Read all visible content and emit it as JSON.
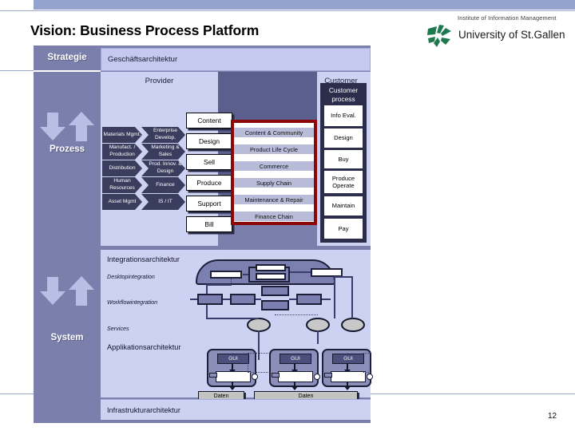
{
  "page": {
    "number": "12"
  },
  "header": {
    "title": "Vision: Business Process Platform",
    "logo_institute": "Institute of Information Management",
    "logo_university": "University of St.Gallen"
  },
  "layers": {
    "strategie": "Strategie",
    "prozess": "Prozess",
    "system": "System"
  },
  "business": {
    "architecture_bar": "Geschäftsarchitektur",
    "provider": "Provider",
    "customer": "Customer"
  },
  "provider_functions": [
    {
      "left": "Materials Mgmt.",
      "right": "Enterprise Develop."
    },
    {
      "left": "Manufact. / Production",
      "right": "Marketing & Sales"
    },
    {
      "left": "Distribution",
      "right": "Prod. Innov. & Design"
    },
    {
      "left": "Human Resources",
      "right": "Finance"
    },
    {
      "left": "Asset Mgmt",
      "right": "IS / IT"
    }
  ],
  "provider_steps": [
    "Content",
    "Design",
    "Sell",
    "Produce",
    "Support",
    "Bill"
  ],
  "platform_services": [
    "Content & Community",
    "Product Life Cycle",
    "Commerce",
    "Supply Chain",
    "Maintenance & Repair",
    "Finance Chain"
  ],
  "customer_process": {
    "title": "Customer process",
    "steps": [
      "Info Eval.",
      "Design",
      "Buy",
      "Produce Operate",
      "Maintain",
      "Pay"
    ]
  },
  "system": {
    "integration_architecture": "Integrationsarchitektur",
    "desktop_integration": "Desktopintegration",
    "workflow_integration": "Workflowintegration",
    "services": "Services",
    "application_architecture": "Applikationsarchitektur",
    "infrastructure_architecture": "Infrastrukturarchitektur",
    "gui_label": "GUI",
    "data_label": "Daten"
  },
  "colors": {
    "frame": "#7b7fab",
    "panel": "#cdd1f2",
    "bar": "#c5c9ef",
    "dark_process": "#3a3d5e",
    "red_border": "#8c0808",
    "banner": "#93a3cd",
    "logo_green": "#1e7a4e"
  }
}
